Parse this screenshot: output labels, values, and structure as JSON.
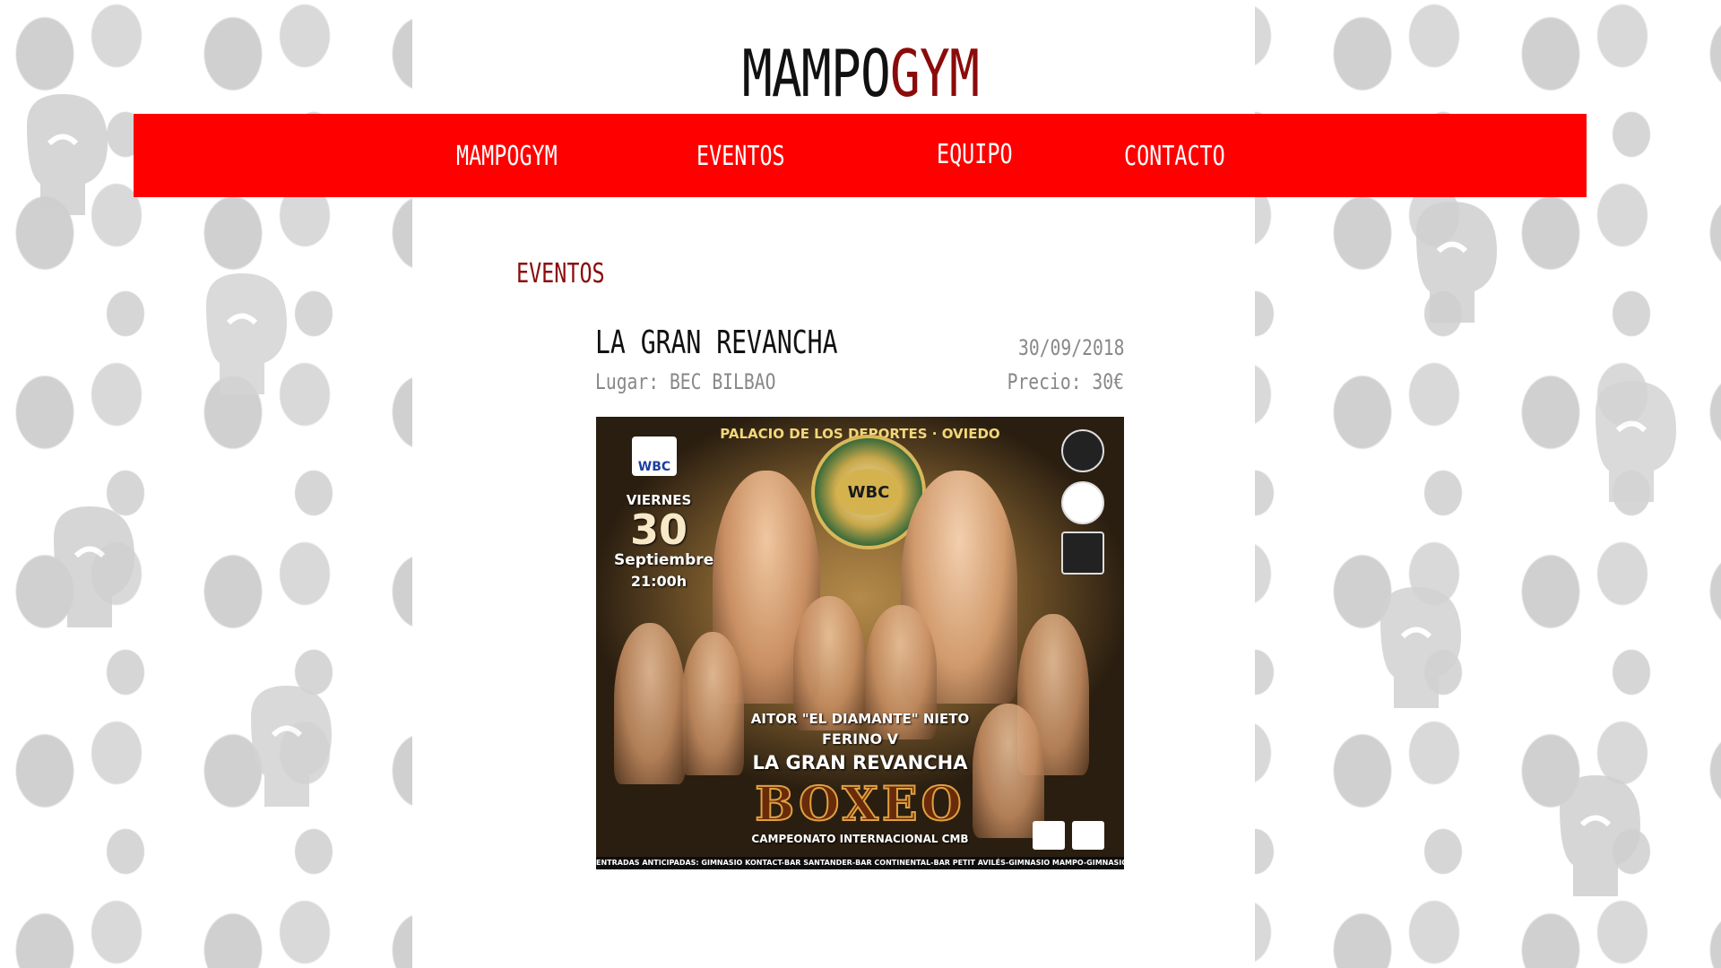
{
  "brand": {
    "part1": "MAMPO",
    "part2": "GYM"
  },
  "nav": {
    "items": [
      {
        "label": "MAMPOGYM"
      },
      {
        "label": "EVENTOS"
      },
      {
        "label": "EQUIPO"
      },
      {
        "label": "CONTACTO"
      }
    ]
  },
  "section": {
    "title": "EVENTOS"
  },
  "event": {
    "name": "LA GRAN REVANCHA",
    "place": "Lugar: BEC BILBAO",
    "date": "30/09/2018",
    "price": "Precio: 30€"
  },
  "poster": {
    "venue": "PALACIO DE LOS DEPORTES · OVIEDO",
    "badge": "WBC",
    "belt": "WBC",
    "weekday": "VIERNES",
    "day": "30",
    "month": "Septiembre",
    "time": "21:00h",
    "line1": "AITOR \"EL DIAMANTE\" NIETO",
    "line2": "FERINO V",
    "line3": "LA GRAN REVANCHA",
    "headline": "BOXEO",
    "subtitle": "CAMPEONATO INTERNACIONAL CMB",
    "footer": "ENTRADAS ANTICIPADAS: GIMNASIO KONTACT-BAR SANTANDER-BAR CONTINENTAL-BAR PETIT AVILÉS-GIMNASIO MAMPO-GIMNASIO TIBET- GIMNASIO ASTURBOX"
  },
  "colors": {
    "nav_bg": "#ff0000",
    "brand_accent": "#8b0b0b",
    "section_title": "#8b0b0b",
    "muted_text": "#888888"
  },
  "icons": {
    "background": "boxing-glove-icon"
  }
}
